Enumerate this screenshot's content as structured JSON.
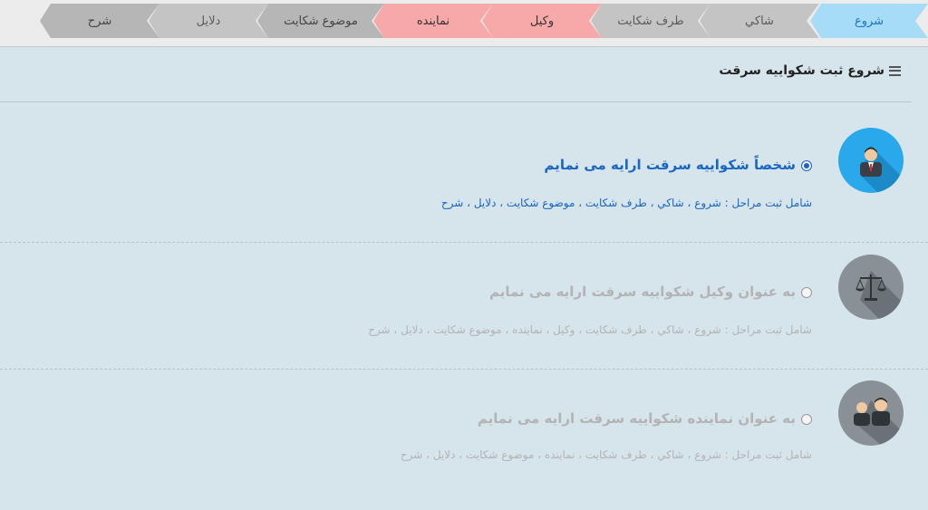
{
  "wizard": {
    "steps": [
      {
        "label": "شروع",
        "state": "active"
      },
      {
        "label": "شاكي",
        "state": "normal"
      },
      {
        "label": "طرف شکايت",
        "state": "normal"
      },
      {
        "label": "وكيل",
        "state": "highlight"
      },
      {
        "label": "نماينده",
        "state": "highlight"
      },
      {
        "label": "موضوع شکايت",
        "state": "dark"
      },
      {
        "label": "دلايل",
        "state": "normal"
      },
      {
        "label": "شرح",
        "state": "dark"
      }
    ]
  },
  "section": {
    "title": "شروع ثبت شكواييه سرقت",
    "icon": "list-icon"
  },
  "options": [
    {
      "title": "شخصاً شكواييه سرقت ارايه مى نمايم",
      "subtitle": "شامل ثبت مراحل : شروع ، شاكي ، طرف شکايت ، موضوع شکايت ، دلايل ، شرح",
      "icon": "person-icon",
      "selected": true
    },
    {
      "title": "به عنوان وكيل شكواييه سرقت ارايه مى نمايم",
      "subtitle": "شامل ثبت مراحل : شروع ، شاكي ، طرف شکايت ، وكيل ، نماينده ، موضوع شکايت ، دلايل ، شرح",
      "icon": "scales-icon",
      "selected": false
    },
    {
      "title": "به عنوان نماينده شكواييه سرقت ارايه مى نمايم",
      "subtitle": "شامل ثبت مراحل : شروع ، شاكي ، طرف شکايت ، نماينده ، موضوع شکايت ، دلايل ، شرح",
      "icon": "group-icon",
      "selected": false
    }
  ],
  "colors": {
    "accent": "#1a66c4",
    "active_step": "#a6dcf6",
    "highlight_step": "#f7a8a8",
    "background": "#d6e4ec"
  }
}
